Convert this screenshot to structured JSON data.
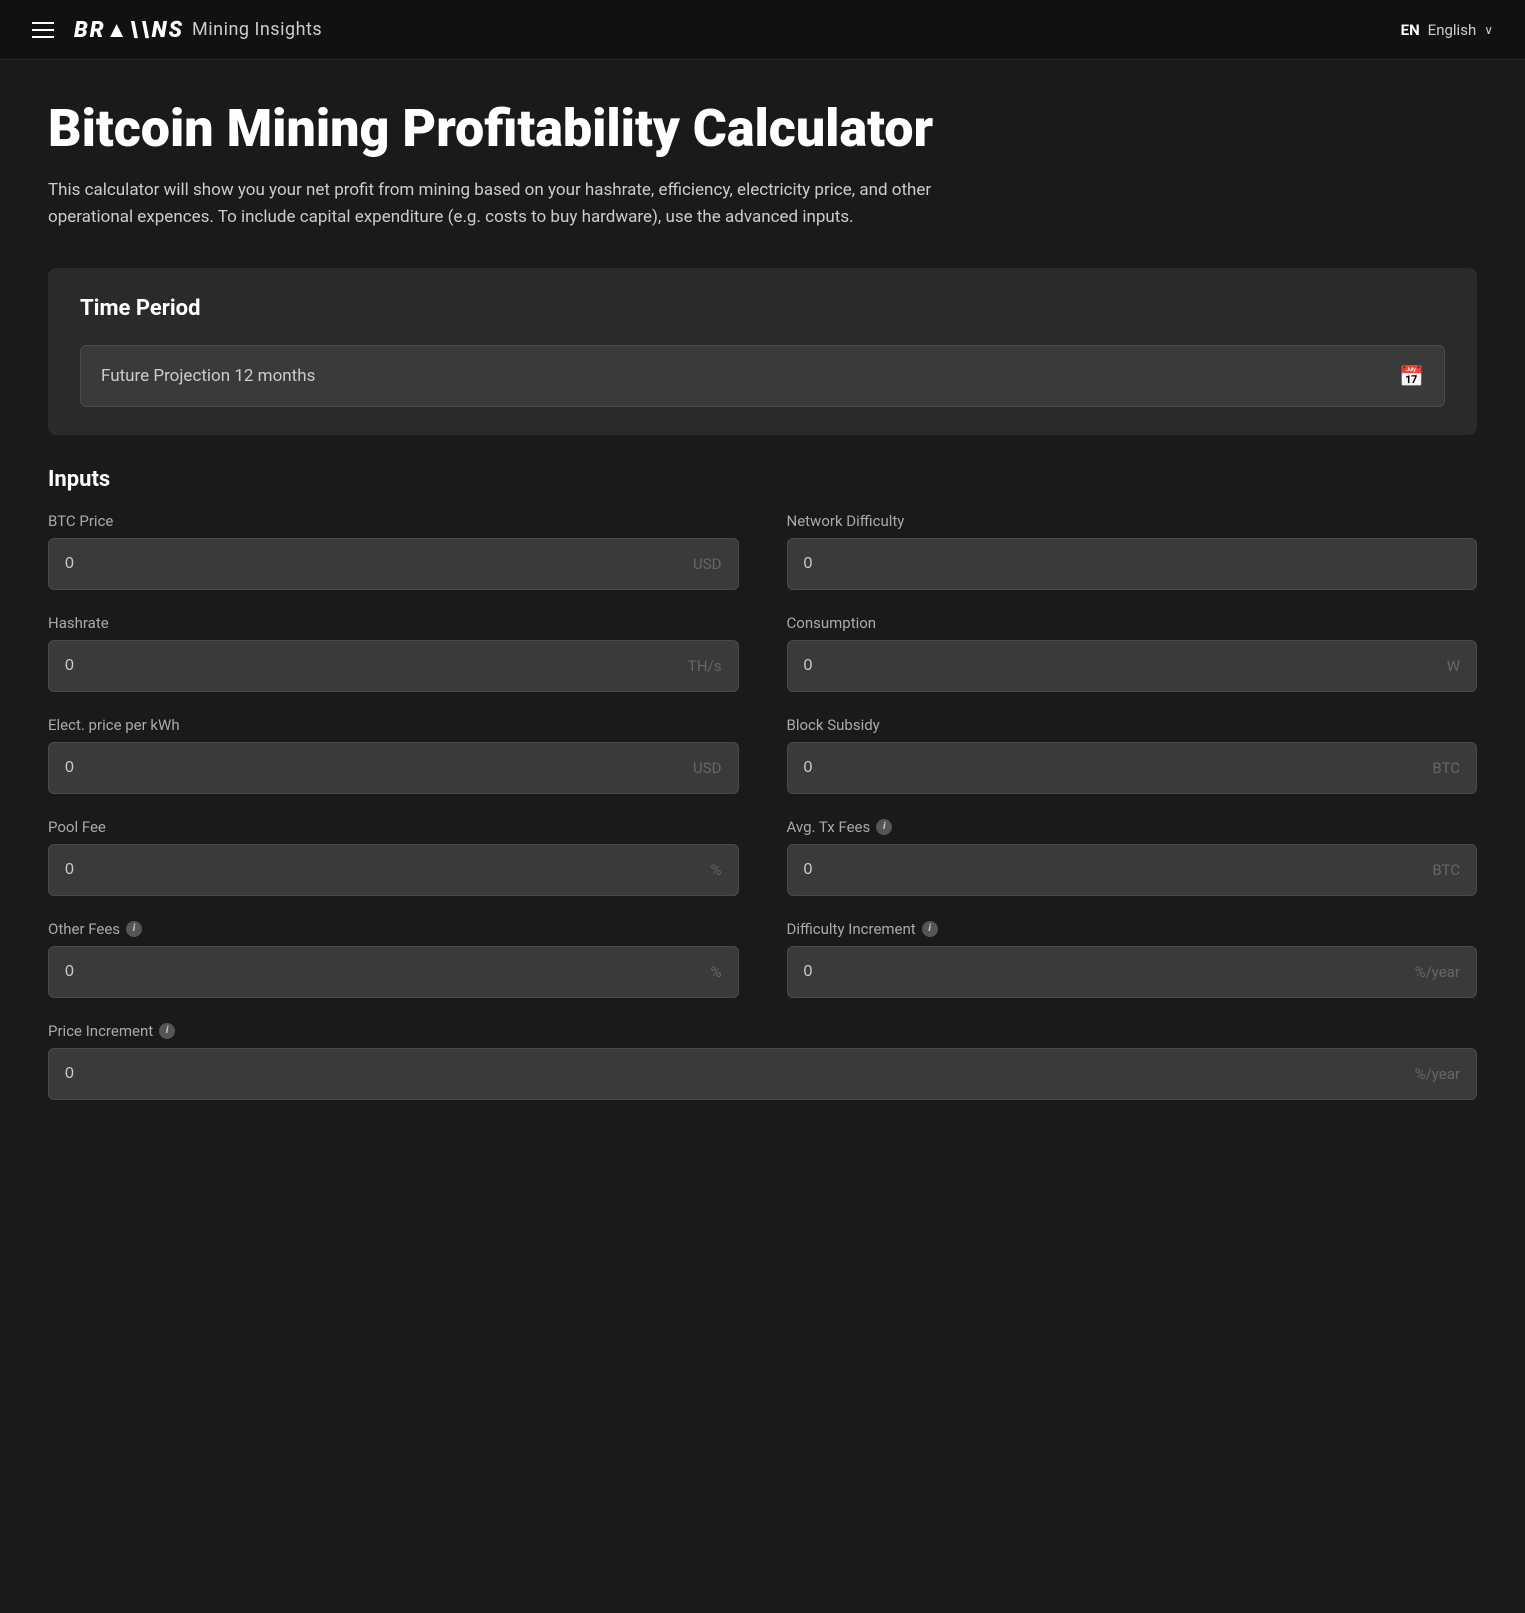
{
  "navbar": {
    "hamburger_label": "menu",
    "brand_logo": "BR▲\\\\NS",
    "brand_title": "Mining Insights",
    "lang_code": "EN",
    "lang_text": "English",
    "chevron": "∨"
  },
  "page": {
    "title": "Bitcoin Mining Profitability Calculator",
    "description": "This calculator will show you your net profit from mining based on your hashrate, efficiency, electricity price, and other operational expences. To include capital expenditure (e.g. costs to buy hardware), use the advanced inputs."
  },
  "time_period": {
    "section_title": "Time Period",
    "selector_label": "Future Projection 12 months",
    "calendar_icon": "🗓"
  },
  "inputs": {
    "section_title": "Inputs",
    "fields": [
      {
        "id": "btc-price",
        "label": "BTC Price",
        "value": "0",
        "unit": "USD",
        "has_info": false,
        "col": "left"
      },
      {
        "id": "network-difficulty",
        "label": "Network Difficulty",
        "value": "0",
        "unit": "",
        "has_info": false,
        "col": "right"
      },
      {
        "id": "hashrate",
        "label": "Hashrate",
        "value": "0",
        "unit": "TH/s",
        "has_info": false,
        "col": "left"
      },
      {
        "id": "consumption",
        "label": "Consumption",
        "value": "0",
        "unit": "W",
        "has_info": false,
        "col": "right"
      },
      {
        "id": "elect-price",
        "label": "Elect. price per kWh",
        "value": "0",
        "unit": "USD",
        "has_info": false,
        "col": "left"
      },
      {
        "id": "block-subsidy",
        "label": "Block Subsidy",
        "value": "0",
        "unit": "BTC",
        "has_info": false,
        "col": "right"
      },
      {
        "id": "pool-fee",
        "label": "Pool Fee",
        "value": "0",
        "unit": "%",
        "has_info": false,
        "col": "left"
      },
      {
        "id": "avg-tx-fees",
        "label": "Avg. Tx Fees",
        "value": "0",
        "unit": "BTC",
        "has_info": true,
        "col": "right"
      },
      {
        "id": "other-fees",
        "label": "Other Fees",
        "value": "0",
        "unit": "%",
        "has_info": true,
        "col": "left"
      },
      {
        "id": "difficulty-increment",
        "label": "Difficulty Increment",
        "value": "0",
        "unit": "%/year",
        "has_info": true,
        "col": "right"
      }
    ],
    "price_increment": {
      "id": "price-increment",
      "label": "Price Increment",
      "value": "0",
      "unit": "%/year",
      "has_info": true
    },
    "info_icon_text": "i"
  }
}
